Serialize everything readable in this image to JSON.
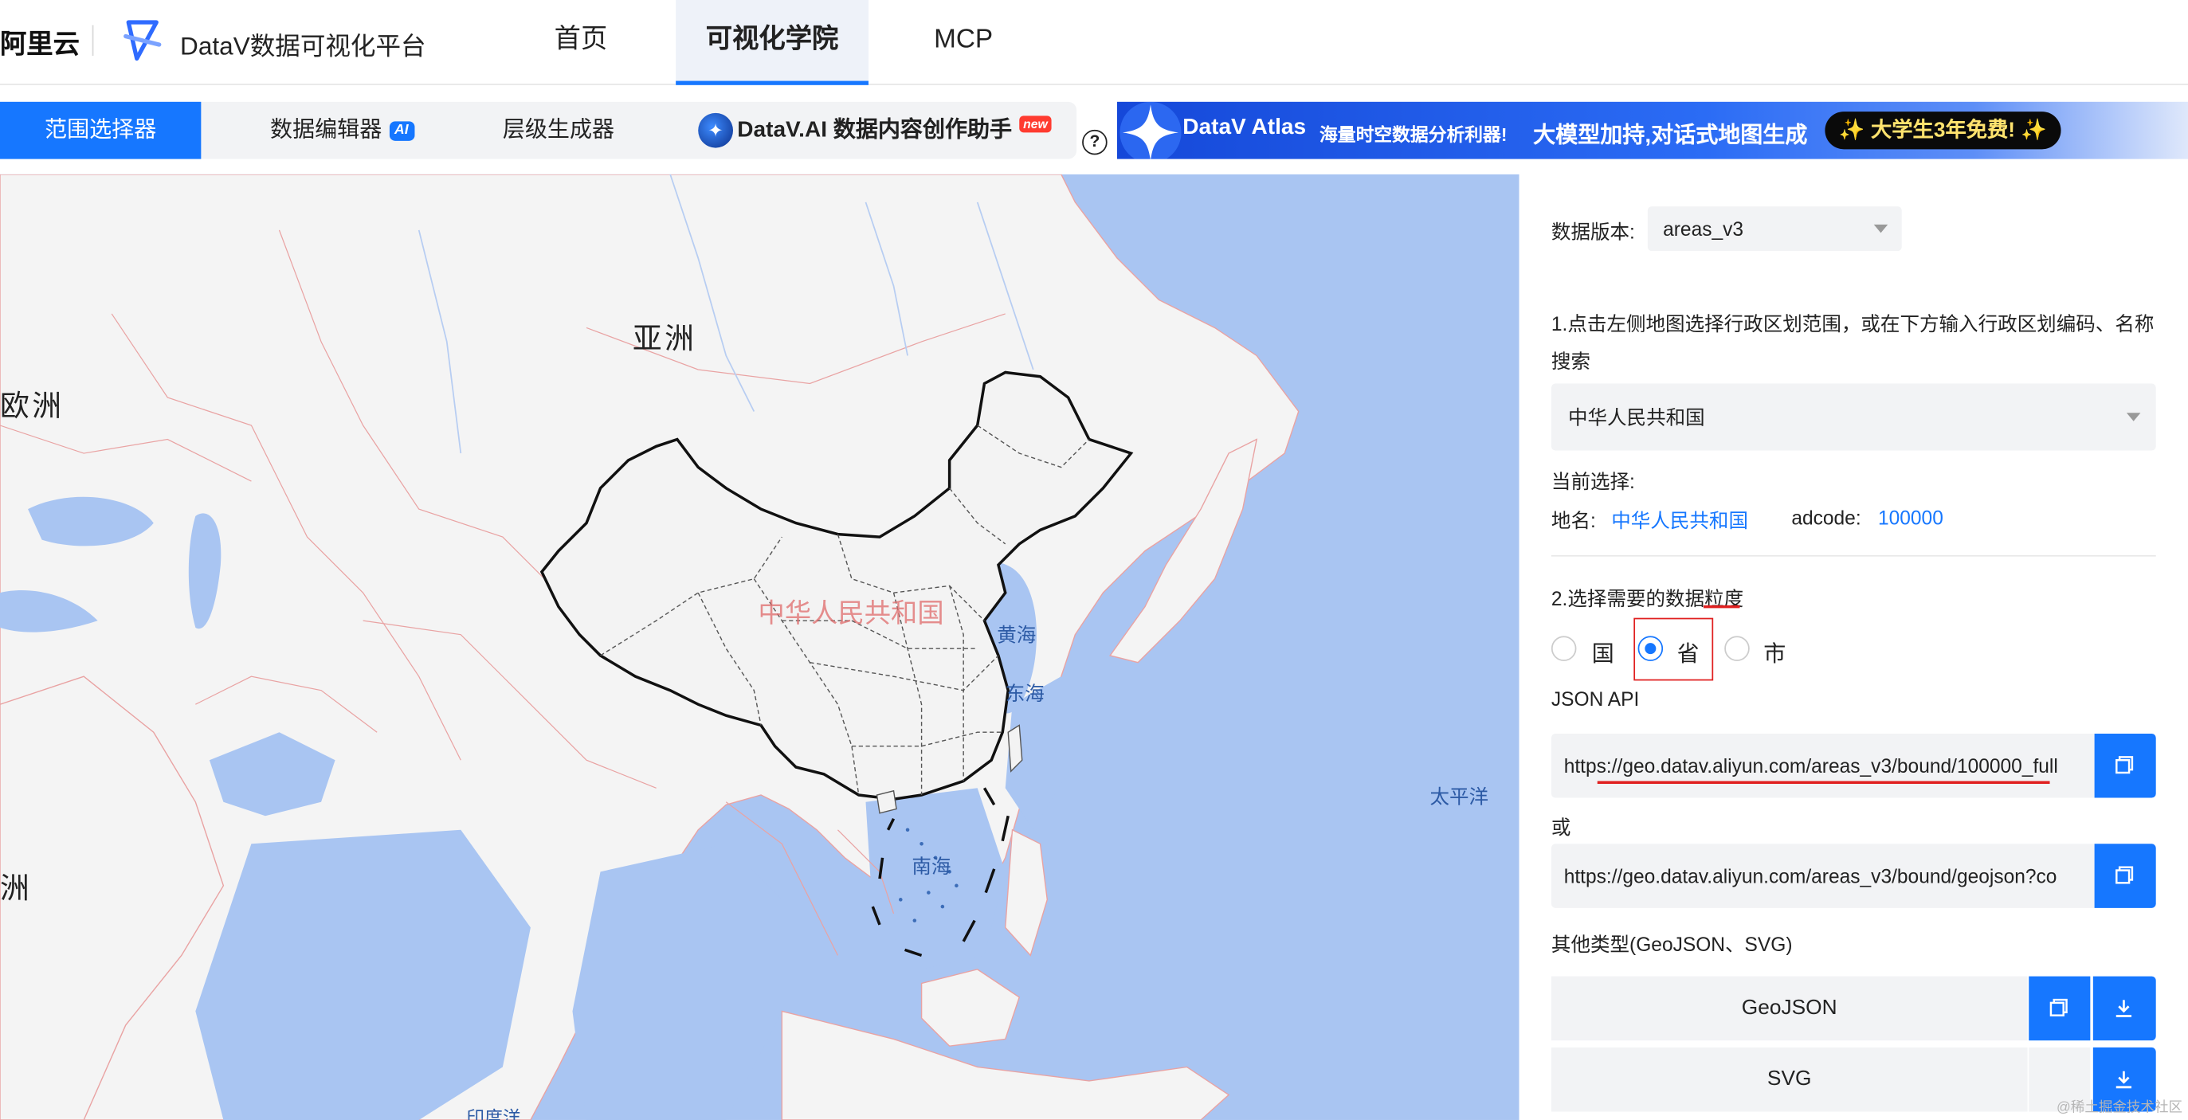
{
  "nav": {
    "brand_aliyun": "阿里云",
    "brand_name": "DataV数据可视化平台",
    "tabs": [
      {
        "label": "首页",
        "active": false
      },
      {
        "label": "可视化学院",
        "active": true
      },
      {
        "label": "MCP",
        "active": false
      }
    ]
  },
  "tools": {
    "tabs": [
      {
        "label": "范围选择器",
        "active": true
      },
      {
        "label": "数据编辑器",
        "badge": "AI"
      },
      {
        "label": "层级生成器"
      },
      {
        "label": "DataV.AI 数据内容创作助手",
        "badge": "new"
      }
    ],
    "help_glyph": "?"
  },
  "banner": {
    "title": "DataV Atlas",
    "subtitle": "海量时空数据分析利器!",
    "slogan": "大模型加持,对话式地图生成",
    "cta": "大学生3年免费!"
  },
  "map": {
    "continents": [
      "亚洲",
      "欧洲",
      "洲"
    ],
    "region_label": "中华人民共和国",
    "seas": [
      "黄海",
      "东海",
      "南海",
      "太平洋",
      "印度洋"
    ],
    "colors": {
      "water": "#a9c5f2",
      "land": "#f4f4f4",
      "selected": "#f3f3f3",
      "border": "#e9a3a3",
      "outline": "#111111"
    }
  },
  "panel": {
    "version_label": "数据版本:",
    "version_value": "areas_v3",
    "step1_text_line1": "1.点击左侧地图选择行政区划范围，或在下方输入行政区划编码、名称",
    "step1_text_line2": "搜索",
    "search_value": "中华人民共和国",
    "current_label": "当前选择:",
    "place_label": "地名:",
    "place_value": "中华人民共和国",
    "adcode_label": "adcode:",
    "adcode_value": "100000",
    "step2_text": "2.选择需要的数据粒度",
    "granularity": [
      {
        "label": "国",
        "checked": false
      },
      {
        "label": "省",
        "checked": true
      },
      {
        "label": "市",
        "checked": false
      }
    ],
    "json_api_label": "JSON API",
    "api_url_1": "https://geo.datav.aliyun.com/areas_v3/bound/100000_full",
    "or_label": "或",
    "api_url_2": "https://geo.datav.aliyun.com/areas_v3/bound/geojson?co",
    "other_types_label": "其他类型(GeoJSON、SVG)",
    "type_geojson": "GeoJSON",
    "type_svg": "SVG",
    "accent": "#1677ff"
  },
  "watermark": "@稀土掘金技术社区"
}
